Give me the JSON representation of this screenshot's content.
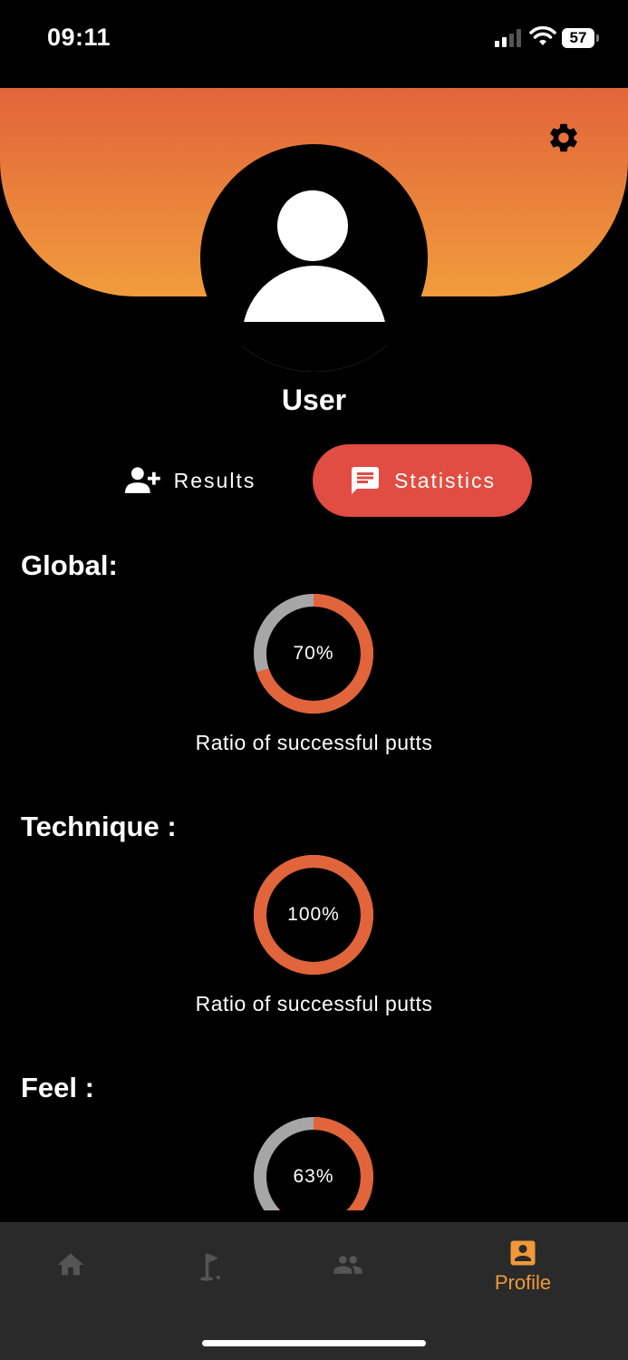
{
  "status_bar": {
    "time": "09:11",
    "battery_level": "57",
    "signal_icon": "cellular-signal-icon",
    "wifi_icon": "wifi-icon"
  },
  "header": {
    "settings_icon": "gear-icon",
    "avatar_icon": "person-icon",
    "gradient_top": "#e2643a",
    "gradient_bottom": "#f09c3c"
  },
  "user": {
    "name": "User"
  },
  "tabs": [
    {
      "label": "Results",
      "icon": "add-person-icon",
      "active": false
    },
    {
      "label": "Statistics",
      "icon": "chat-icon",
      "active": true
    }
  ],
  "stats": [
    {
      "title": "Global:",
      "percent": 70,
      "label": "70%",
      "caption": "Ratio of successful putts"
    },
    {
      "title": "Technique :",
      "percent": 100,
      "label": "100%",
      "caption": "Ratio of successful putts"
    },
    {
      "title": "Feel :",
      "percent": 63,
      "label": "63%",
      "caption": ""
    }
  ],
  "colors": {
    "accent": "#e2643a",
    "active_tab": "#e14d42",
    "donut_track": "#a6a6a6",
    "nav_active": "#f0983a",
    "nav_inactive": "#555555"
  },
  "bottom_nav": {
    "items": [
      {
        "icon": "home-icon",
        "label": "",
        "active": false
      },
      {
        "icon": "golf-flag-icon",
        "label": "",
        "active": false
      },
      {
        "icon": "group-icon",
        "label": "",
        "active": false
      },
      {
        "icon": "account-box-icon",
        "label": "Profile",
        "active": true
      }
    ]
  }
}
